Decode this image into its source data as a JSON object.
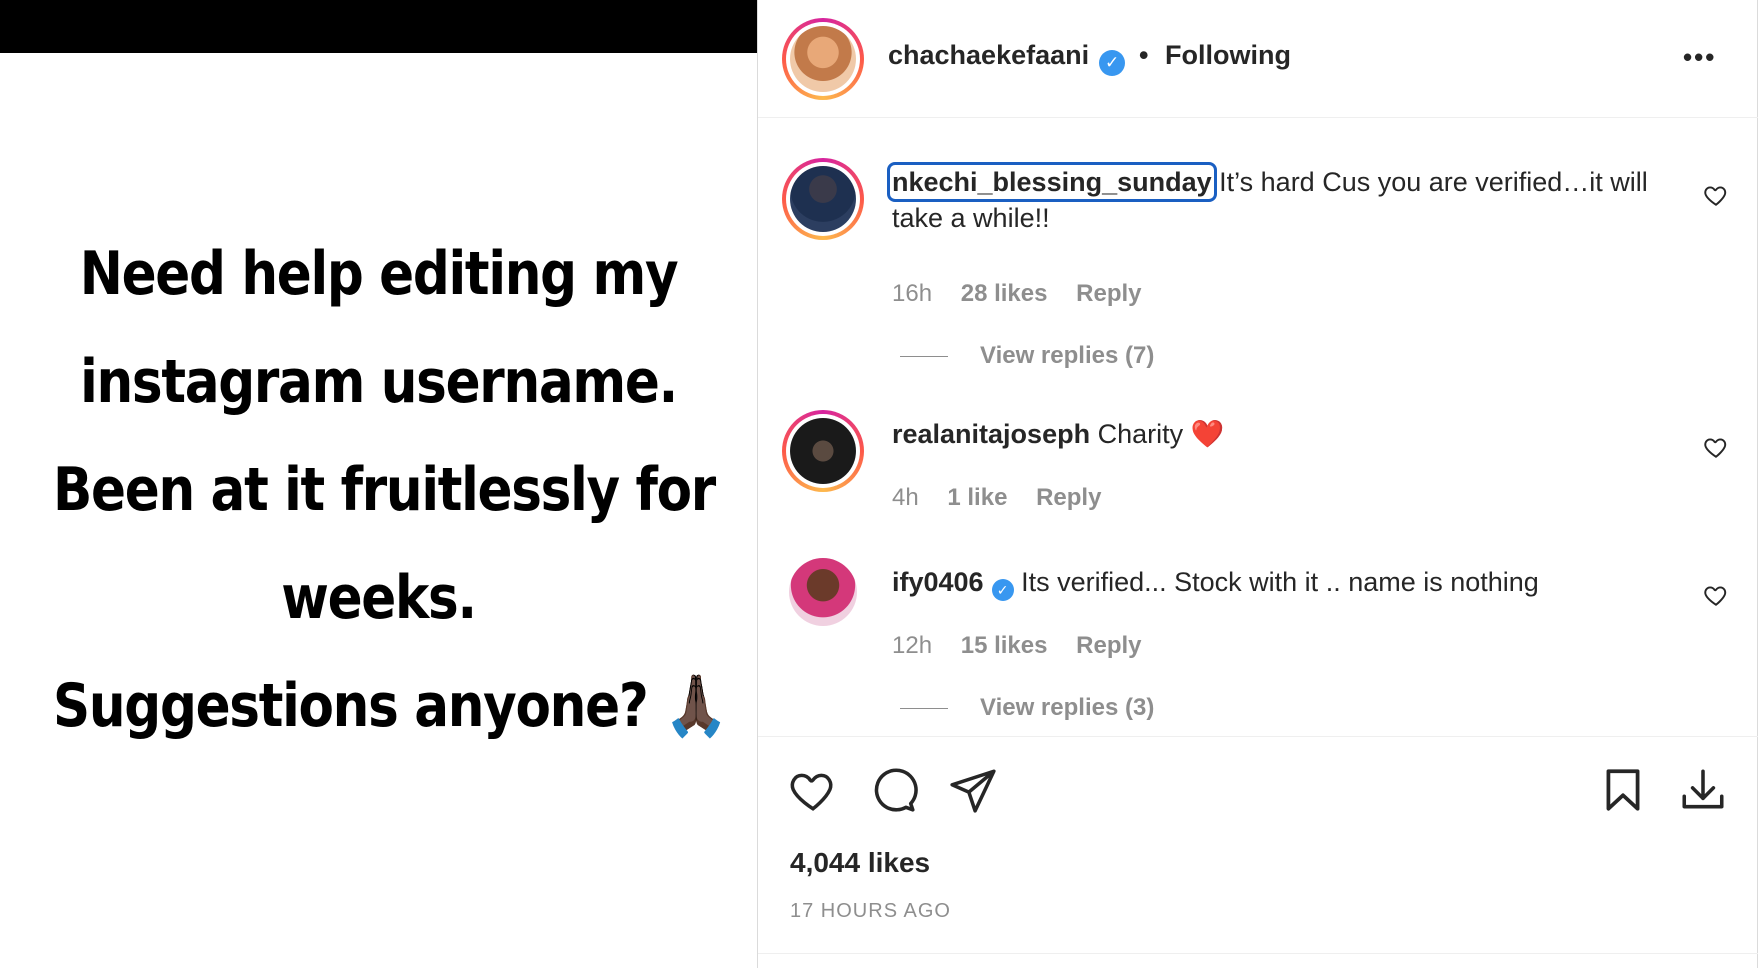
{
  "media": {
    "lines": [
      "Need help editing my",
      "instagram username.",
      "Been at it fruitlessly for",
      "weeks.",
      "Suggestions anyone? 🙏🏿"
    ]
  },
  "header": {
    "username": "chachaekefaani",
    "separator": "•",
    "follow_status": "Following",
    "more_icon": "more-options-icon"
  },
  "comments": [
    {
      "username": "nkechi_blessing_sunday",
      "text": "It’s hard Cus you are verified…it will take a while!!",
      "time": "16h",
      "likes": "28 likes",
      "reply": "Reply",
      "view_replies": "View replies (7)"
    },
    {
      "username": "realanitajoseph",
      "text": "Charity ❤️",
      "time": "4h",
      "likes": "1 like",
      "reply": "Reply"
    },
    {
      "username": "ify0406",
      "verified": true,
      "text": "Its verified... Stock with it .. name is nothing",
      "time": "12h",
      "likes": "15 likes",
      "reply": "Reply",
      "view_replies": "View replies (3)"
    }
  ],
  "footer": {
    "likes": "4,044 likes",
    "time_ago": "17 HOURS AGO"
  },
  "colors": {
    "text": "#262626",
    "muted": "#8e8e8e",
    "verified": "#3897f0",
    "focus": "#1a5fc2"
  }
}
